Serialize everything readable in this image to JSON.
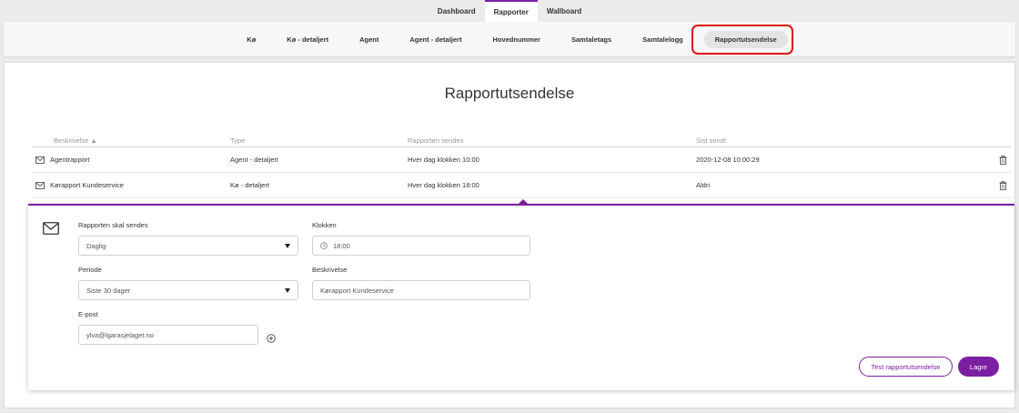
{
  "topnav": {
    "tabs": [
      {
        "label": "Dashboard"
      },
      {
        "label": "Rapporter"
      },
      {
        "label": "Wallboard"
      }
    ]
  },
  "subnav": {
    "items": [
      {
        "label": "Kø"
      },
      {
        "label": "Kø - detaljert"
      },
      {
        "label": "Agent"
      },
      {
        "label": "Agent - detaljert"
      },
      {
        "label": "Hovednummer"
      },
      {
        "label": "Samtaletags"
      },
      {
        "label": "Samtalelogg"
      },
      {
        "label": "Rapportutsendelse"
      }
    ]
  },
  "page": {
    "title": "Rapportutsendelse"
  },
  "table": {
    "headers": {
      "description": "Beskrivelse ▲",
      "type": "Type",
      "schedule": "Rapporten sendes",
      "last_sent": "Sist sendt"
    },
    "rows": [
      {
        "description": "Agentrapport",
        "type": "Agent - detaljert",
        "schedule": "Hver dag klokken 10:00",
        "last_sent": "2020-12-08 10:00:29"
      },
      {
        "description": "Kørapport Kundeservice",
        "type": "Kø - detaljert",
        "schedule": "Hver dag klokken 18:00",
        "last_sent": "Aldri"
      }
    ]
  },
  "editor": {
    "frequency_label": "Rapporten skal sendes",
    "frequency_value": "Daglig",
    "time_label": "Klokken",
    "time_value": "18:00",
    "period_label": "Periode",
    "period_value": "Siste 30 dager",
    "description_label": "Beskrivelse",
    "description_value": "Kørapport Kundeservice",
    "email_label": "E-post",
    "email_value": "ylva@lgarasjelaget.no",
    "test_button": "Test rapportutsendelse",
    "save_button": "Lagre"
  },
  "colors": {
    "accent": "#7b1fa2",
    "highlight": "#e01010"
  }
}
